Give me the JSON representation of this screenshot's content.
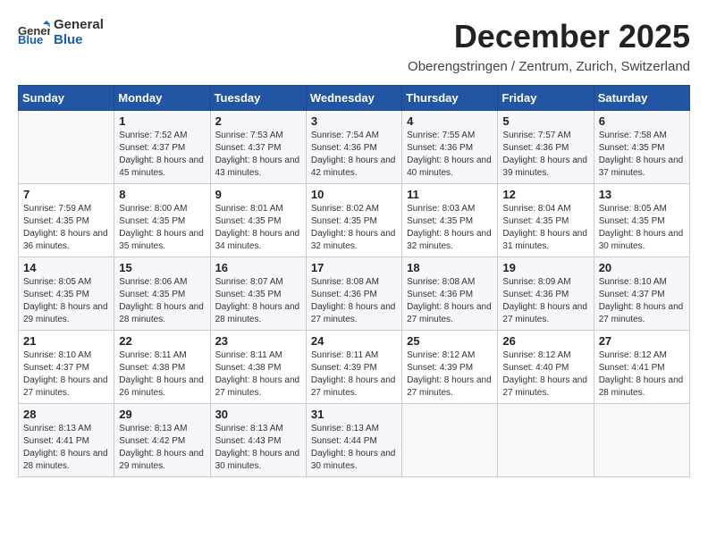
{
  "header": {
    "month_year": "December 2025",
    "location": "Oberengstringen / Zentrum, Zurich, Switzerland",
    "logo_general": "General",
    "logo_blue": "Blue"
  },
  "weekdays": [
    "Sunday",
    "Monday",
    "Tuesday",
    "Wednesday",
    "Thursday",
    "Friday",
    "Saturday"
  ],
  "weeks": [
    [
      {
        "day": "",
        "sunrise": "",
        "sunset": "",
        "daylight": ""
      },
      {
        "day": "1",
        "sunrise": "Sunrise: 7:52 AM",
        "sunset": "Sunset: 4:37 PM",
        "daylight": "Daylight: 8 hours and 45 minutes."
      },
      {
        "day": "2",
        "sunrise": "Sunrise: 7:53 AM",
        "sunset": "Sunset: 4:37 PM",
        "daylight": "Daylight: 8 hours and 43 minutes."
      },
      {
        "day": "3",
        "sunrise": "Sunrise: 7:54 AM",
        "sunset": "Sunset: 4:36 PM",
        "daylight": "Daylight: 8 hours and 42 minutes."
      },
      {
        "day": "4",
        "sunrise": "Sunrise: 7:55 AM",
        "sunset": "Sunset: 4:36 PM",
        "daylight": "Daylight: 8 hours and 40 minutes."
      },
      {
        "day": "5",
        "sunrise": "Sunrise: 7:57 AM",
        "sunset": "Sunset: 4:36 PM",
        "daylight": "Daylight: 8 hours and 39 minutes."
      },
      {
        "day": "6",
        "sunrise": "Sunrise: 7:58 AM",
        "sunset": "Sunset: 4:35 PM",
        "daylight": "Daylight: 8 hours and 37 minutes."
      }
    ],
    [
      {
        "day": "7",
        "sunrise": "Sunrise: 7:59 AM",
        "sunset": "Sunset: 4:35 PM",
        "daylight": "Daylight: 8 hours and 36 minutes."
      },
      {
        "day": "8",
        "sunrise": "Sunrise: 8:00 AM",
        "sunset": "Sunset: 4:35 PM",
        "daylight": "Daylight: 8 hours and 35 minutes."
      },
      {
        "day": "9",
        "sunrise": "Sunrise: 8:01 AM",
        "sunset": "Sunset: 4:35 PM",
        "daylight": "Daylight: 8 hours and 34 minutes."
      },
      {
        "day": "10",
        "sunrise": "Sunrise: 8:02 AM",
        "sunset": "Sunset: 4:35 PM",
        "daylight": "Daylight: 8 hours and 32 minutes."
      },
      {
        "day": "11",
        "sunrise": "Sunrise: 8:03 AM",
        "sunset": "Sunset: 4:35 PM",
        "daylight": "Daylight: 8 hours and 32 minutes."
      },
      {
        "day": "12",
        "sunrise": "Sunrise: 8:04 AM",
        "sunset": "Sunset: 4:35 PM",
        "daylight": "Daylight: 8 hours and 31 minutes."
      },
      {
        "day": "13",
        "sunrise": "Sunrise: 8:05 AM",
        "sunset": "Sunset: 4:35 PM",
        "daylight": "Daylight: 8 hours and 30 minutes."
      }
    ],
    [
      {
        "day": "14",
        "sunrise": "Sunrise: 8:05 AM",
        "sunset": "Sunset: 4:35 PM",
        "daylight": "Daylight: 8 hours and 29 minutes."
      },
      {
        "day": "15",
        "sunrise": "Sunrise: 8:06 AM",
        "sunset": "Sunset: 4:35 PM",
        "daylight": "Daylight: 8 hours and 28 minutes."
      },
      {
        "day": "16",
        "sunrise": "Sunrise: 8:07 AM",
        "sunset": "Sunset: 4:35 PM",
        "daylight": "Daylight: 8 hours and 28 minutes."
      },
      {
        "day": "17",
        "sunrise": "Sunrise: 8:08 AM",
        "sunset": "Sunset: 4:36 PM",
        "daylight": "Daylight: 8 hours and 27 minutes."
      },
      {
        "day": "18",
        "sunrise": "Sunrise: 8:08 AM",
        "sunset": "Sunset: 4:36 PM",
        "daylight": "Daylight: 8 hours and 27 minutes."
      },
      {
        "day": "19",
        "sunrise": "Sunrise: 8:09 AM",
        "sunset": "Sunset: 4:36 PM",
        "daylight": "Daylight: 8 hours and 27 minutes."
      },
      {
        "day": "20",
        "sunrise": "Sunrise: 8:10 AM",
        "sunset": "Sunset: 4:37 PM",
        "daylight": "Daylight: 8 hours and 27 minutes."
      }
    ],
    [
      {
        "day": "21",
        "sunrise": "Sunrise: 8:10 AM",
        "sunset": "Sunset: 4:37 PM",
        "daylight": "Daylight: 8 hours and 27 minutes."
      },
      {
        "day": "22",
        "sunrise": "Sunrise: 8:11 AM",
        "sunset": "Sunset: 4:38 PM",
        "daylight": "Daylight: 8 hours and 26 minutes."
      },
      {
        "day": "23",
        "sunrise": "Sunrise: 8:11 AM",
        "sunset": "Sunset: 4:38 PM",
        "daylight": "Daylight: 8 hours and 27 minutes."
      },
      {
        "day": "24",
        "sunrise": "Sunrise: 8:11 AM",
        "sunset": "Sunset: 4:39 PM",
        "daylight": "Daylight: 8 hours and 27 minutes."
      },
      {
        "day": "25",
        "sunrise": "Sunrise: 8:12 AM",
        "sunset": "Sunset: 4:39 PM",
        "daylight": "Daylight: 8 hours and 27 minutes."
      },
      {
        "day": "26",
        "sunrise": "Sunrise: 8:12 AM",
        "sunset": "Sunset: 4:40 PM",
        "daylight": "Daylight: 8 hours and 27 minutes."
      },
      {
        "day": "27",
        "sunrise": "Sunrise: 8:12 AM",
        "sunset": "Sunset: 4:41 PM",
        "daylight": "Daylight: 8 hours and 28 minutes."
      }
    ],
    [
      {
        "day": "28",
        "sunrise": "Sunrise: 8:13 AM",
        "sunset": "Sunset: 4:41 PM",
        "daylight": "Daylight: 8 hours and 28 minutes."
      },
      {
        "day": "29",
        "sunrise": "Sunrise: 8:13 AM",
        "sunset": "Sunset: 4:42 PM",
        "daylight": "Daylight: 8 hours and 29 minutes."
      },
      {
        "day": "30",
        "sunrise": "Sunrise: 8:13 AM",
        "sunset": "Sunset: 4:43 PM",
        "daylight": "Daylight: 8 hours and 30 minutes."
      },
      {
        "day": "31",
        "sunrise": "Sunrise: 8:13 AM",
        "sunset": "Sunset: 4:44 PM",
        "daylight": "Daylight: 8 hours and 30 minutes."
      },
      {
        "day": "",
        "sunrise": "",
        "sunset": "",
        "daylight": ""
      },
      {
        "day": "",
        "sunrise": "",
        "sunset": "",
        "daylight": ""
      },
      {
        "day": "",
        "sunrise": "",
        "sunset": "",
        "daylight": ""
      }
    ]
  ]
}
